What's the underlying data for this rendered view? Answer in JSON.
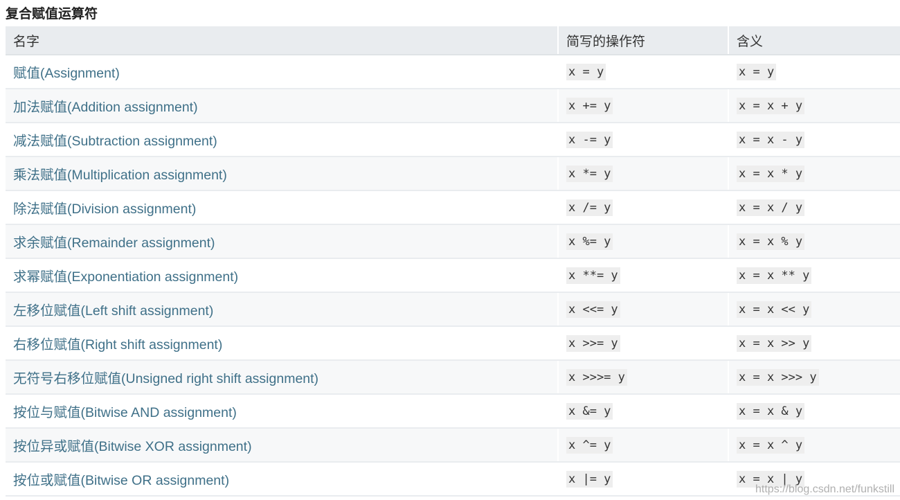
{
  "title": "复合赋值运算符",
  "table": {
    "headers": [
      "名字",
      "简写的操作符",
      "含义"
    ],
    "rows": [
      {
        "name": "赋值(Assignment)",
        "op": "x = y",
        "meaning": "x = y"
      },
      {
        "name": "加法赋值(Addition assignment)",
        "op": "x += y",
        "meaning": "x = x + y"
      },
      {
        "name": "减法赋值(Subtraction assignment)",
        "op": "x -= y",
        "meaning": "x = x - y"
      },
      {
        "name": "乘法赋值(Multiplication assignment)",
        "op": "x *= y",
        "meaning": "x = x * y"
      },
      {
        "name": "除法赋值(Division assignment)",
        "op": "x /= y",
        "meaning": "x = x / y"
      },
      {
        "name": "求余赋值(Remainder assignment)",
        "op": "x %= y",
        "meaning": "x = x % y"
      },
      {
        "name": "求幂赋值(Exponentiation assignment)",
        "op": "x **= y",
        "meaning": "x = x ** y"
      },
      {
        "name": "左移位赋值(Left shift assignment)",
        "op": "x <<= y",
        "meaning": "x = x << y"
      },
      {
        "name": "右移位赋值(Right shift assignment)",
        "op": "x >>= y",
        "meaning": "x = x >> y"
      },
      {
        "name": "无符号右移位赋值(Unsigned right shift assignment)",
        "op": "x >>>= y",
        "meaning": "x = x >>> y"
      },
      {
        "name": "按位与赋值(Bitwise AND assignment)",
        "op": "x &= y",
        "meaning": "x = x & y"
      },
      {
        "name": "按位异或赋值(Bitwise XOR assignment)",
        "op": "x ^= y",
        "meaning": "x = x ^ y"
      },
      {
        "name": "按位或赋值(Bitwise OR assignment)",
        "op": "x |= y",
        "meaning": "x = x | y"
      }
    ]
  },
  "watermark": "https://blog.csdn.net/funkstill",
  "colors": {
    "link": "#3f7088",
    "header_bg": "#e9ecef",
    "code_bg": "#eeeeee"
  }
}
